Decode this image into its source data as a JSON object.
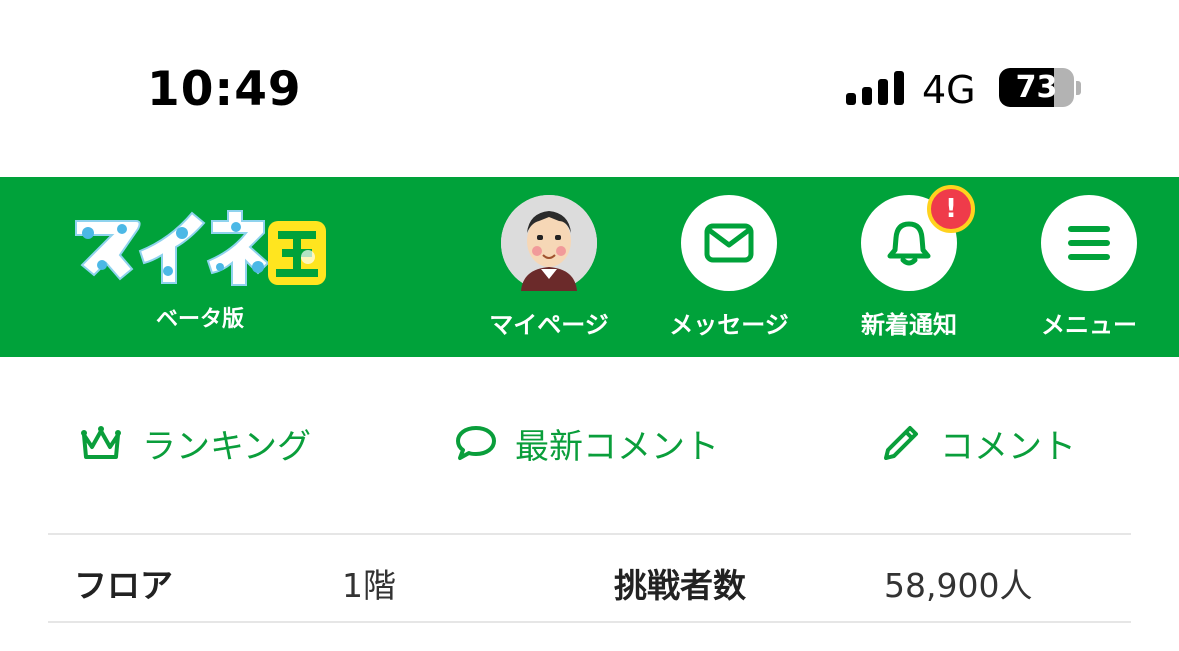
{
  "status_bar": {
    "time": "10:49",
    "network": "4G",
    "battery_percent": "73",
    "battery_level": 0.73
  },
  "header": {
    "logo_text": "マイネ王",
    "logo_sub": "ベータ版",
    "nav": [
      {
        "label": "マイページ",
        "icon": "avatar"
      },
      {
        "label": "メッセージ",
        "icon": "envelope-icon"
      },
      {
        "label": "新着通知",
        "icon": "bell-icon",
        "badge": "!"
      },
      {
        "label": "メニュー",
        "icon": "hamburger-icon"
      }
    ]
  },
  "subnav": [
    {
      "label": "ランキング",
      "icon": "crown-icon"
    },
    {
      "label": "最新コメント",
      "icon": "speech-bubble-icon"
    },
    {
      "label": "コメント",
      "icon": "pencil-icon"
    }
  ],
  "info": {
    "floor_label": "フロア",
    "floor_value": "1階",
    "challengers_label": "挑戦者数",
    "challengers_value": "58,900人"
  },
  "colors": {
    "brand_green": "#00a23a",
    "link_green": "#0a9e3b",
    "badge_red": "#ef3b4a",
    "badge_border": "#ffd21e"
  }
}
